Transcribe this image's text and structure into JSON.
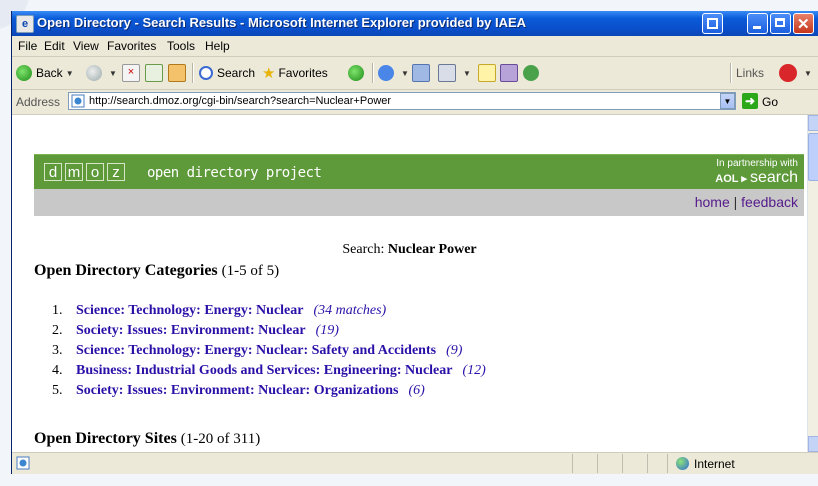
{
  "window": {
    "title": "Open Directory - Search Results - Microsoft Internet Explorer provided by IAEA"
  },
  "menu": {
    "items": [
      "File",
      "Edit",
      "View",
      "Favorites",
      "Tools",
      "Help"
    ]
  },
  "toolbar": {
    "back_label": "Back",
    "search_label": "Search",
    "favorites_label": "Favorites",
    "links_label": "Links"
  },
  "address": {
    "label": "Address",
    "url": "http://search.dmoz.org/cgi-bin/search?search=Nuclear+Power",
    "go_label": "Go"
  },
  "dmoz": {
    "logo_letters": [
      "d",
      "m",
      "o",
      "z"
    ],
    "tagline": "open directory project",
    "partner_text": "In partnership with",
    "aol_text": "AOL",
    "aol_search": "search",
    "nav_home": "home",
    "nav_sep": "|",
    "nav_feedback": "feedback"
  },
  "search": {
    "label": "Search:",
    "query": "Nuclear Power"
  },
  "categories": {
    "heading": "Open Directory Categories",
    "count": "(1-5 of 5)",
    "items": [
      {
        "num": "1.",
        "label": "Science: Technology: Energy: Nuclear",
        "matches": "(34 matches)"
      },
      {
        "num": "2.",
        "label": "Society: Issues: Environment: Nuclear",
        "matches": "(19)"
      },
      {
        "num": "3.",
        "label": "Science: Technology: Energy: Nuclear: Safety and Accidents",
        "matches": "(9)"
      },
      {
        "num": "4.",
        "label": "Business: Industrial Goods and Services: Engineering: Nuclear",
        "matches": "(12)"
      },
      {
        "num": "5.",
        "label": "Society: Issues: Environment: Nuclear: Organizations",
        "matches": "(6)"
      }
    ]
  },
  "sites": {
    "heading": "Open Directory Sites",
    "count": "(1-20 of 311)"
  },
  "status": {
    "zone": "Internet"
  },
  "colors": {
    "dmoz_green": "#5e9a3a",
    "link_blue": "#2b10a8",
    "titlebar_blue": "#0a4fcc"
  }
}
